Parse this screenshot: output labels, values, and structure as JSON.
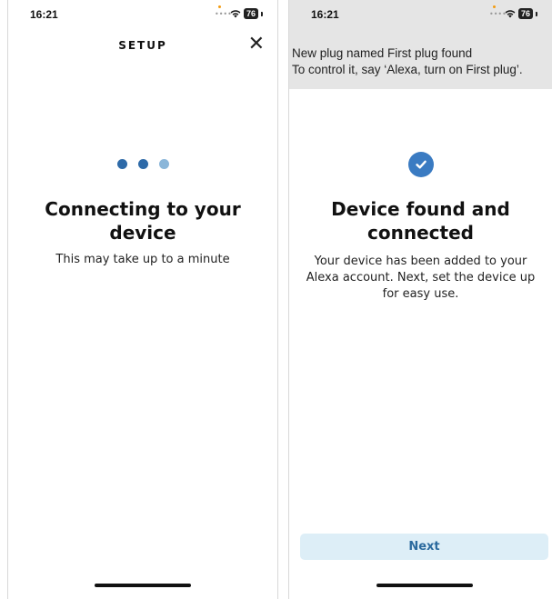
{
  "left_screen": {
    "status": {
      "time": "16:21",
      "battery": "76"
    },
    "title": "SETUP",
    "close_icon": "close-icon",
    "heading": "Connecting to your device",
    "subtext": "This may take up to a minute",
    "dot_colors": [
      "#2e6aa8",
      "#2e6aa8",
      "#8ab6d9"
    ]
  },
  "right_screen": {
    "status": {
      "time": "16:21",
      "battery": "76"
    },
    "notification": {
      "line1": "New plug named First plug found",
      "line2": "To control it, say ‘Alexa, turn on First plug’."
    },
    "check_icon": "checkmark-icon",
    "heading": "Device found and connected",
    "subtext": "Your device has been added to your Alexa account. Next, set the device up for easy use.",
    "next_label": "Next"
  },
  "colors": {
    "accent": "#3a7bc2",
    "button_bg": "#ddeef7",
    "button_text": "#2b6a9e",
    "notification_bg": "#e5e5e5"
  }
}
